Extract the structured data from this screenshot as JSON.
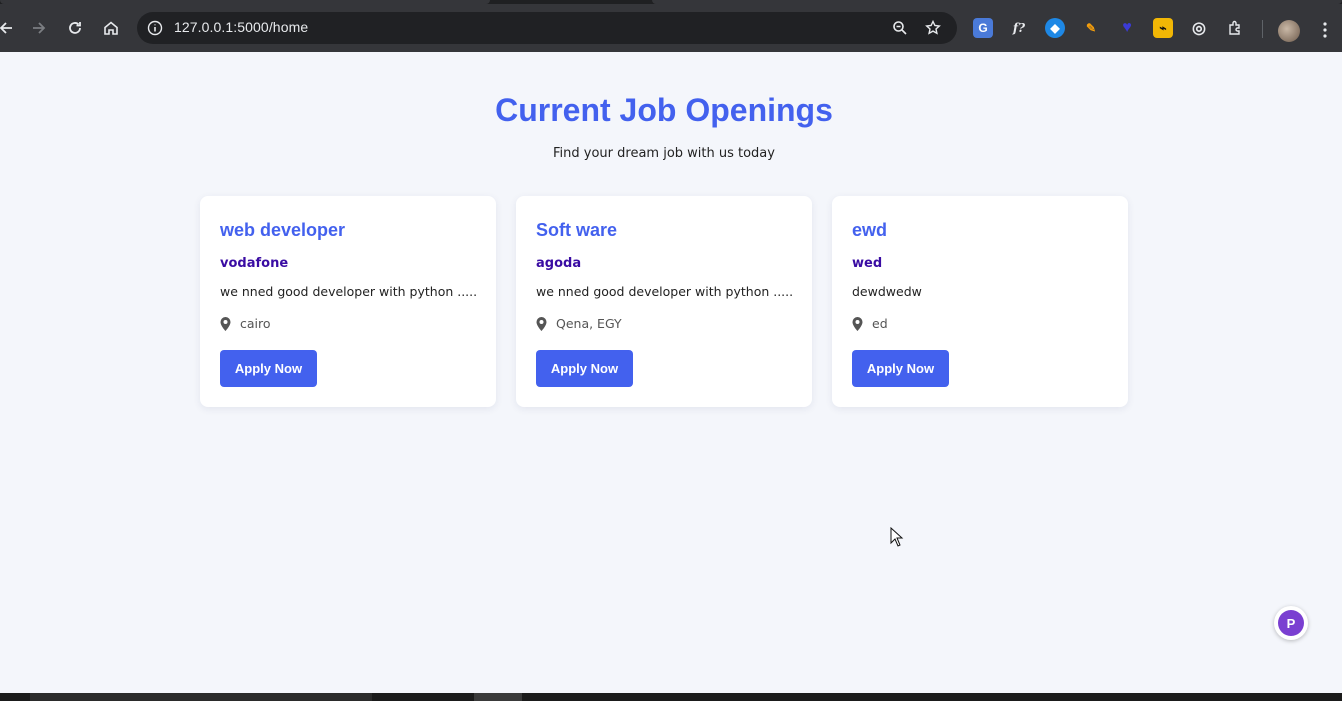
{
  "browser": {
    "url": "127.0.0.1:5000/home",
    "icons": [
      "back-icon",
      "forward-icon",
      "reload-icon",
      "home-icon",
      "site-info-icon",
      "zoom-icon",
      "bookmark-star-icon",
      "extensions-icon",
      "profile-avatar",
      "menu-icon"
    ]
  },
  "hero": {
    "title": "Current Job Openings",
    "subtitle": "Find your dream job with us today"
  },
  "jobs": [
    {
      "title": "web developer",
      "company": "vodafone",
      "description": "we nned good developer with python .....",
      "location": "cairo",
      "button": "Apply Now"
    },
    {
      "title": "Soft ware",
      "company": "agoda",
      "description": "we nned good developer with python .....",
      "location": "Qena, EGY",
      "button": "Apply Now"
    },
    {
      "title": "ewd",
      "company": "wed",
      "description": "dewdwedw",
      "location": "ed",
      "button": "Apply Now"
    }
  ],
  "colors": {
    "accent": "#4361ee",
    "company": "#3a0ca3",
    "background": "#f4f6fb"
  },
  "floating_badge": {
    "label": "P"
  }
}
